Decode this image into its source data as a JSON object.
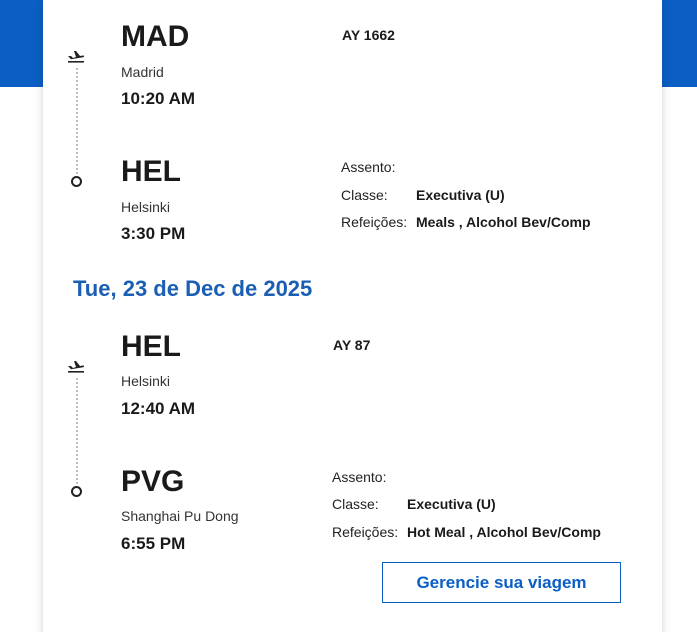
{
  "colors": {
    "brand_blue": "#0b5fc4",
    "date_blue": "#1a5fb4"
  },
  "segments": [
    {
      "flight_number": "AY 1662",
      "departure": {
        "code": "MAD",
        "city": "Madrid",
        "time": "10:20 AM"
      },
      "arrival": {
        "code": "HEL",
        "city": "Helsinki",
        "time": "3:30 PM"
      },
      "details": {
        "seat_label": "Assento:",
        "seat_value": "",
        "class_label": "Classe:",
        "class_value": "Executiva (U)",
        "meals_label": "Refeições:",
        "meals_value": "Meals , Alcohol Bev/Comp"
      }
    },
    {
      "flight_number": "AY 87",
      "departure": {
        "code": "HEL",
        "city": "Helsinki",
        "time": "12:40 AM"
      },
      "arrival": {
        "code": "PVG",
        "city": "Shanghai Pu Dong",
        "time": "6:55 PM"
      },
      "details": {
        "seat_label": "Assento:",
        "seat_value": "",
        "class_label": "Classe:",
        "class_value": "Executiva (U)",
        "meals_label": "Refeições:",
        "meals_value": "Hot Meal , Alcohol Bev/Comp"
      }
    }
  ],
  "date_header": "Tue, 23 de Dec de 2025",
  "manage_button_label": "Gerencie sua viagem",
  "icons": {
    "departure": "plane-takeoff-icon",
    "arrival": "circle-marker-icon"
  }
}
